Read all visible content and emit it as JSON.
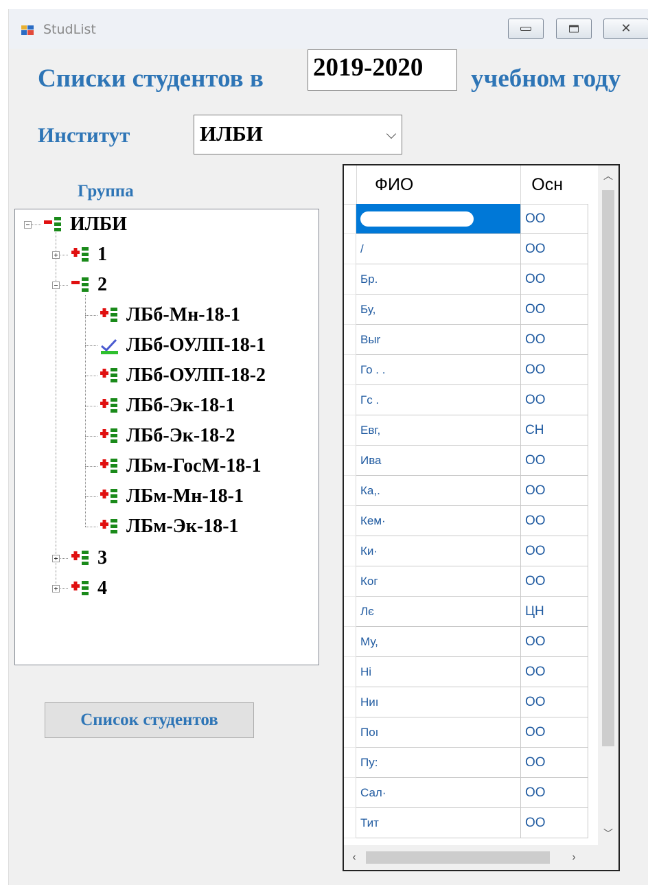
{
  "window": {
    "title": "StudList",
    "minimize_icon": "minimize-icon",
    "maximize_icon": "maximize-icon",
    "close_icon": "close-icon",
    "close_glyph": "✕"
  },
  "header": {
    "prefix": "Списки студентов в",
    "year": "2019-2020",
    "suffix": "учебном году"
  },
  "institute": {
    "label": "Институт",
    "selected": "ИЛБИ"
  },
  "group": {
    "label": "Группа",
    "tree": {
      "root": "ИЛБИ",
      "courses": [
        {
          "label": "1",
          "expanded": false
        },
        {
          "label": "2",
          "expanded": true,
          "groups": [
            "ЛБб-Мн-18-1",
            "ЛБб-ОУЛП-18-1",
            "ЛБб-ОУЛП-18-2",
            "ЛБб-Эк-18-1",
            "ЛБб-Эк-18-2",
            "ЛБм-ГосМ-18-1",
            "ЛБм-Мн-18-1",
            "ЛБм-Эк-18-1"
          ]
        },
        {
          "label": "3",
          "expanded": false
        },
        {
          "label": "4",
          "expanded": false
        }
      ],
      "checked_group": "ЛБб-ОУЛП-18-1"
    }
  },
  "buttons": {
    "student_list": "Список студентов"
  },
  "grid": {
    "columns": {
      "fio": "ФИО",
      "osn": "Осн"
    },
    "rows": [
      {
        "fio": "",
        "osn": "ОО"
      },
      {
        "fio": "/",
        "osn": "ОО"
      },
      {
        "fio": "Бр.",
        "osn": "ОО"
      },
      {
        "fio": "Бу,",
        "osn": "ОО"
      },
      {
        "fio": "Выr",
        "osn": "ОО"
      },
      {
        "fio": "Го​   .  .",
        "osn": "ОО"
      },
      {
        "fio": "Гс      .",
        "osn": "ОО"
      },
      {
        "fio": "Евг,",
        "osn": "СН"
      },
      {
        "fio": "Ива",
        "osn": "ОО"
      },
      {
        "fio": "Ка,.",
        "osn": "ОО"
      },
      {
        "fio": "Кем·",
        "osn": "ОО"
      },
      {
        "fio": "Ки·",
        "osn": "ОО"
      },
      {
        "fio": "Ког",
        "osn": "ОО"
      },
      {
        "fio": "Лє",
        "osn": "ЦН"
      },
      {
        "fio": "Му,",
        "osn": "ОО"
      },
      {
        "fio": "Ні",
        "osn": "ОО"
      },
      {
        "fio": "Ниı",
        "osn": "ОО"
      },
      {
        "fio": "Поı",
        "osn": "ОО"
      },
      {
        "fio": "Пу:",
        "osn": "ОО"
      },
      {
        "fio": "Сал·",
        "osn": "ОО"
      },
      {
        "fio": "Тит",
        "osn": "ОО"
      }
    ],
    "selected_row": 0,
    "vertical_scroll_fraction": 0.0,
    "horizontal_scroll_fraction": 0.0
  },
  "colors": {
    "accent": "#2e75b6",
    "selection": "#0078d7",
    "cell_text": "#1f5aa0"
  }
}
